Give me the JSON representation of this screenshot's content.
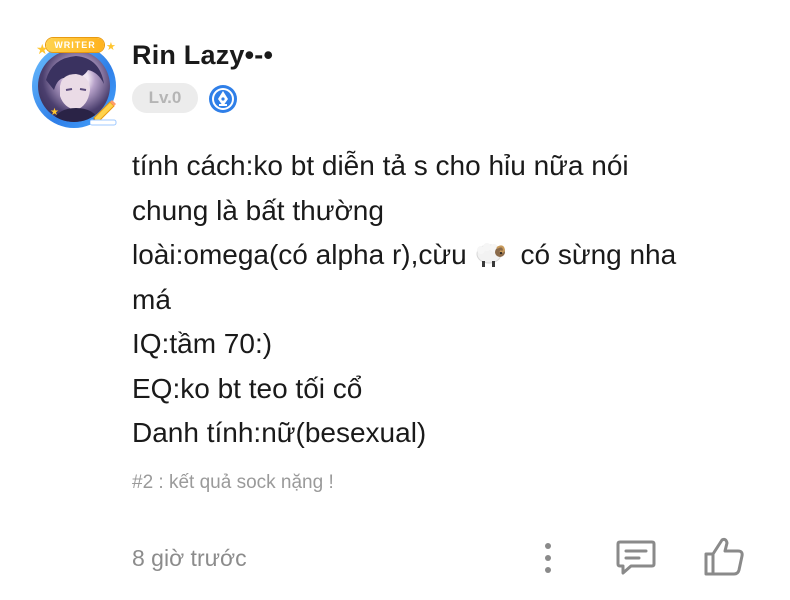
{
  "post": {
    "author": {
      "name": "Rin Lazy•-•",
      "level": "Lv.0",
      "badge": "WRITER",
      "verified_icon": "pen-nib-icon"
    },
    "body_lines": [
      "tính cách:ko bt diễn tả s cho hỉu nữa nói",
      "chung là bất thường",
      "loài:omega(có alpha r),cừu",
      " có sừng nha",
      "má",
      "IQ:tầm 70:)",
      "EQ:ko bt teo tối cổ",
      "Danh tính:nữ(besexual)"
    ],
    "note": "#2 : kết quả sock nặng !",
    "timestamp": "8 giờ trước",
    "actions": {
      "more_icon": "more-vertical-icon",
      "comment_icon": "comment-icon",
      "like_icon": "thumbs-up-icon"
    }
  },
  "colors": {
    "text": "#1a1a1a",
    "muted": "#8c8c8c",
    "level_bg": "#ececec",
    "level_text": "#b5b5b5",
    "verified": "#2f7fe8",
    "badge": "#ffc52e"
  }
}
